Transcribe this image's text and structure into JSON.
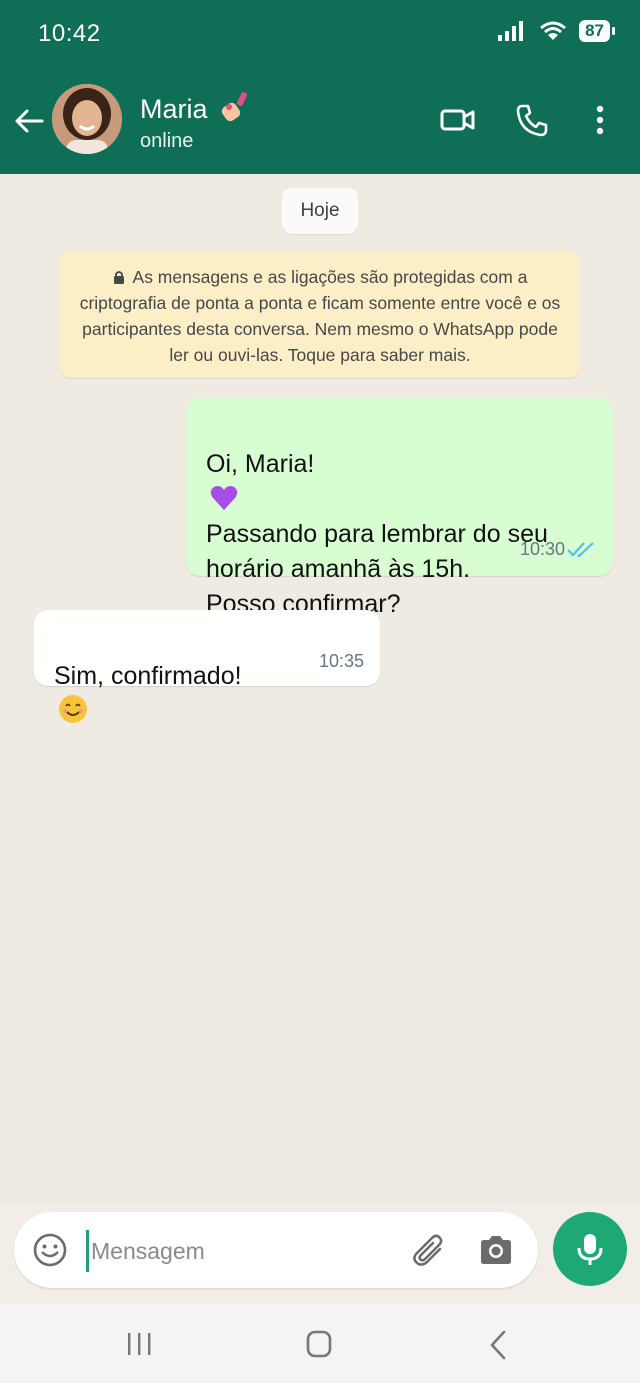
{
  "status_bar": {
    "time": "10:42",
    "battery": "87"
  },
  "header": {
    "contact_name": "Maria",
    "contact_status": "online",
    "icons": [
      "back-arrow-icon",
      "video-call-icon",
      "phone-icon",
      "more-options-icon"
    ]
  },
  "chat": {
    "date_label": "Hoje",
    "encryption_notice": "As mensagens e as ligações são protegidas com a criptografia de ponta a ponta e ficam somente entre você e os participantes desta conversa. Nem mesmo o WhatsApp pode ler ou ouvi-las. Toque para saber mais.",
    "messages": [
      {
        "direction": "outgoing",
        "line1": "Oi, Maria!",
        "line2": "Passando para lembrar do seu\nhorário amanhã às 15h.\nPosso confirmar?",
        "time": "10:30",
        "status": "read"
      },
      {
        "direction": "incoming",
        "text": "Sim, confirmado!",
        "time": "10:35"
      }
    ]
  },
  "input": {
    "placeholder": "Mensagem",
    "value": ""
  },
  "colors": {
    "header_green": "#0f6e56",
    "outgoing_bubble": "#d9fdd3",
    "incoming_bubble": "#ffffff",
    "notice_bg": "#fcefc8",
    "mic_button": "#1da875",
    "read_ticks": "#53bdeb"
  }
}
